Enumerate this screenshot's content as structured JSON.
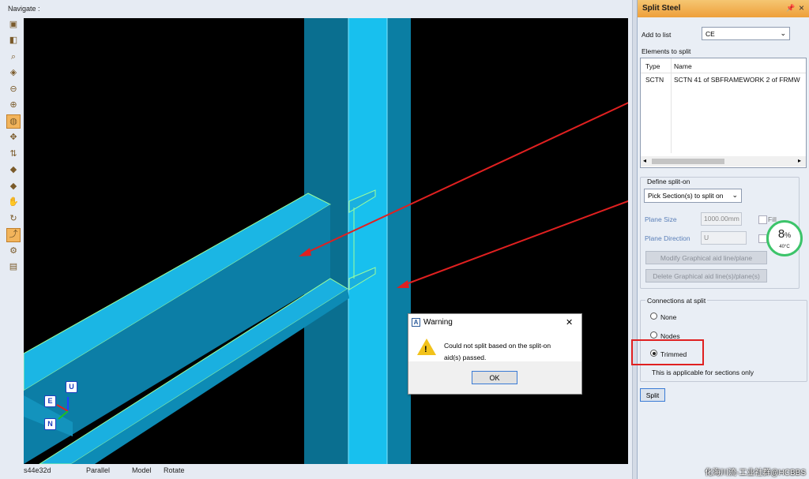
{
  "navigate": {
    "title": "Navigate :",
    "toolbar_icons": [
      "view-icon",
      "layers-icon",
      "zoom-icon",
      "box-icon",
      "zoom-out-icon",
      "magnifier-icon",
      "orbit-icon",
      "pan-icon",
      "walk-icon",
      "section-icon",
      "clip-icon",
      "hand-icon",
      "refresh-icon",
      "rotate-icon",
      "settings-icon",
      "window-icon"
    ],
    "status": {
      "id": "s44e32d",
      "projection": "Parallel",
      "mode": "Model",
      "action": "Rotate"
    },
    "axes": {
      "u": "U",
      "e": "E",
      "n": "N"
    }
  },
  "panel": {
    "title": "Split Steel",
    "pin_glyph": "📌",
    "close_glyph": "×",
    "add_to_list_label": "Add to list",
    "add_to_list_value": "CE",
    "elements_label": "Elements to split",
    "columns": [
      "Type",
      "Name"
    ],
    "rows": [
      {
        "type": "SCTN",
        "name": "SCTN 41 of SBFRAMEWORK 2 of FRMW"
      }
    ],
    "define_split_label": "Define split-on",
    "split_method": "Pick Section(s) to split on",
    "plane_size_label": "Plane Size",
    "plane_size_value": "1000.00mm",
    "fill_label": "Fill",
    "plane_direction_label": "Plane Direction",
    "plane_direction_value": "U",
    "modify_button": "Modify Graphical aid line/plane",
    "delete_button": "Delete Graphical aid line(s)/plane(s)",
    "connections_label": "Connections at split",
    "options": [
      "None",
      "Nodes",
      "Trimmed"
    ],
    "selected_option": "Trimmed",
    "note": "This is applicable for sections only",
    "split_button": "Split"
  },
  "dialog": {
    "title": "Warning",
    "message_line1": "Could not split based on the split-on",
    "message_line2": "aid(s) passed.",
    "ok": "OK",
    "close": "✕"
  },
  "widget": {
    "percent": "8",
    "unit": "%",
    "temp": "40°C"
  },
  "watermark": "化海川流-工业社群@HCBBS",
  "colors": {
    "steel": "#1ab0e0",
    "highlight": "#ff2020",
    "accent": "#f0a040"
  }
}
